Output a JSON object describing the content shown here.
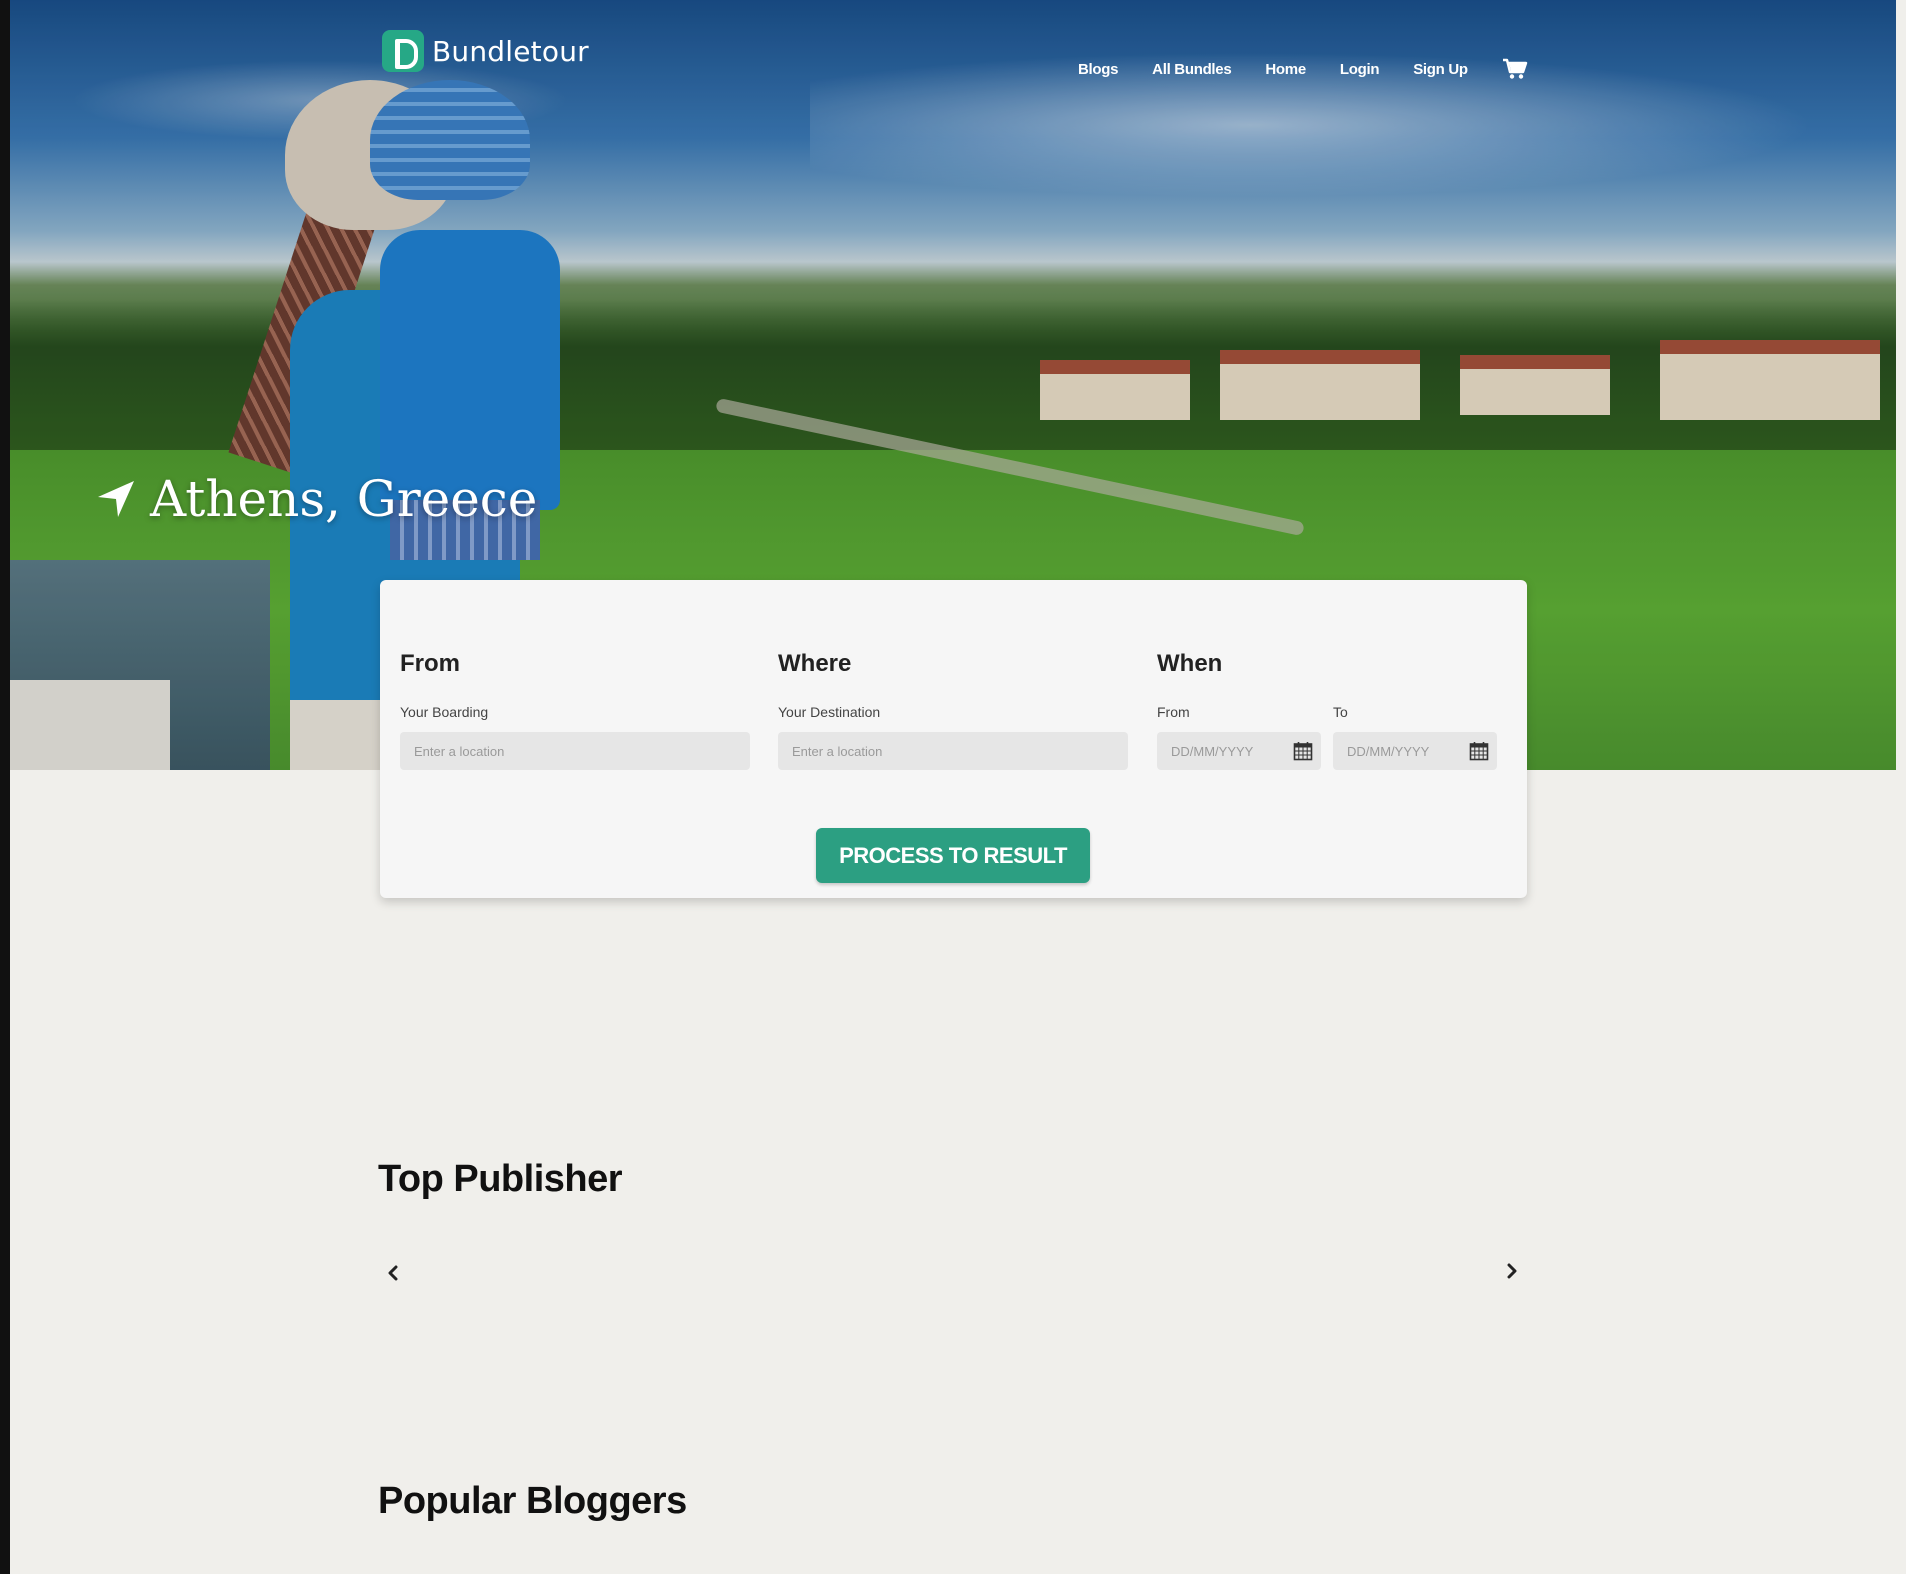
{
  "brand": {
    "name": "Bundletour",
    "accent": "#2c9f82"
  },
  "nav": {
    "items": [
      {
        "label": "Blogs"
      },
      {
        "label": "All Bundles"
      },
      {
        "label": "Home"
      },
      {
        "label": "Login"
      },
      {
        "label": "Sign Up"
      }
    ],
    "cart_icon": "shopping-cart-icon"
  },
  "hero": {
    "location": "Athens, Greece",
    "icon": "location-arrow-icon"
  },
  "search": {
    "from": {
      "title": "From",
      "label": "Your Boarding",
      "placeholder": "Enter a location"
    },
    "where": {
      "title": "Where",
      "label": "Your Destination",
      "placeholder": "Enter a location"
    },
    "when": {
      "title": "When",
      "from_label": "From",
      "from_placeholder": "DD/MM/YYYY",
      "to_label": "To",
      "to_placeholder": "DD/MM/YYYY",
      "icon": "calendar-icon"
    },
    "button": "PROCESS TO RESULT"
  },
  "sections": {
    "top_publisher": "Top Publisher",
    "popular_bloggers": "Popular Bloggers"
  }
}
